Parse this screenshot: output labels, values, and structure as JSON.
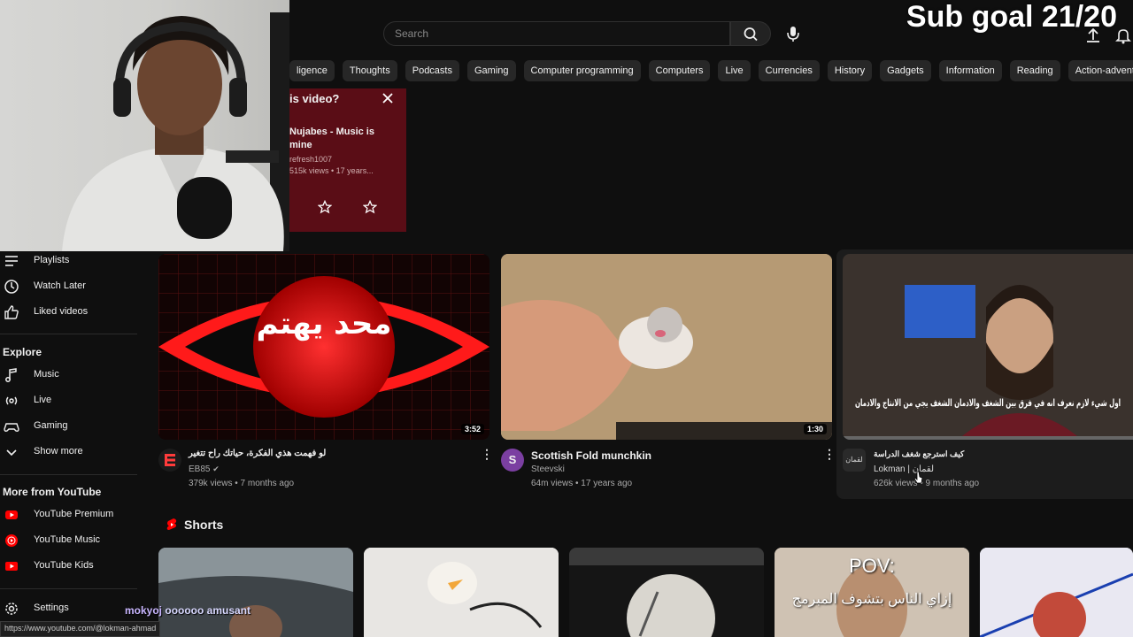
{
  "search": {
    "placeholder": "Search"
  },
  "overlay": {
    "sub_goal": "Sub goal 21/20",
    "chat_user": "mokyoj",
    "chat_message": "oooooo amusant"
  },
  "chips": [
    "ligence",
    "Thoughts",
    "Podcasts",
    "Gaming",
    "Computer programming",
    "Computers",
    "Live",
    "Currencies",
    "History",
    "Gadgets",
    "Information",
    "Reading",
    "Action-adventure gam"
  ],
  "popup": {
    "question": "is video?",
    "title": "Nujabes - Music is mine",
    "channel": "refresh1007",
    "meta": "515k views • 17 years..."
  },
  "sidebar": {
    "items": [
      {
        "label": "Playlists",
        "icon": "playlist-icon"
      },
      {
        "label": "Watch Later",
        "icon": "clock-icon"
      },
      {
        "label": "Liked videos",
        "icon": "thumbs-up-icon"
      }
    ],
    "explore_heading": "Explore",
    "explore": [
      {
        "label": "Music",
        "icon": "music-note-icon"
      },
      {
        "label": "Live",
        "icon": "live-icon"
      },
      {
        "label": "Gaming",
        "icon": "gamepad-icon"
      },
      {
        "label": "Show more",
        "icon": "chevron-down-icon"
      }
    ],
    "more_heading": "More from YouTube",
    "more": [
      {
        "label": "YouTube Premium",
        "icon": "youtube-premium-icon"
      },
      {
        "label": "YouTube Music",
        "icon": "youtube-music-icon"
      },
      {
        "label": "YouTube Kids",
        "icon": "youtube-kids-icon"
      }
    ],
    "settings": {
      "label": "Settings",
      "icon": "gear-icon"
    }
  },
  "videos": [
    {
      "title": "لو فهمت هذي الفكرة، حياتك راح تتغير",
      "thumb_text": "محد يهتم",
      "channel": "EB85",
      "meta": "379k views • 7 months ago",
      "duration": "3:52"
    },
    {
      "title": "Scottish Fold munchkin",
      "channel": "Steevski",
      "meta": "64m views • 17 years ago",
      "duration": "1:30",
      "avatar_letter": "S"
    },
    {
      "title": "كيف استرجع شغف الدراسة",
      "thumb_text": "اول شيء لازم نعرف انه في فرق بين الشغف والادمان الشغف يجي من الانتاج والادمان",
      "channel": "Lokman | لقمان",
      "meta": "626k views • 9 months ago"
    }
  ],
  "shorts": {
    "heading": "Shorts",
    "items": [
      {
        "overlay": ""
      },
      {
        "overlay": ""
      },
      {
        "overlay": ""
      },
      {
        "overlay": "POV:",
        "overlay2": "إزاي الناس بتشوف المبرمج"
      },
      {
        "overlay": ""
      }
    ]
  },
  "status": {
    "url": "https://www.youtube.com/@lokman-ahmad"
  },
  "colors": {
    "brand_red": "#ff0000",
    "background": "#0f0f0f",
    "chip_bg": "#272727"
  }
}
